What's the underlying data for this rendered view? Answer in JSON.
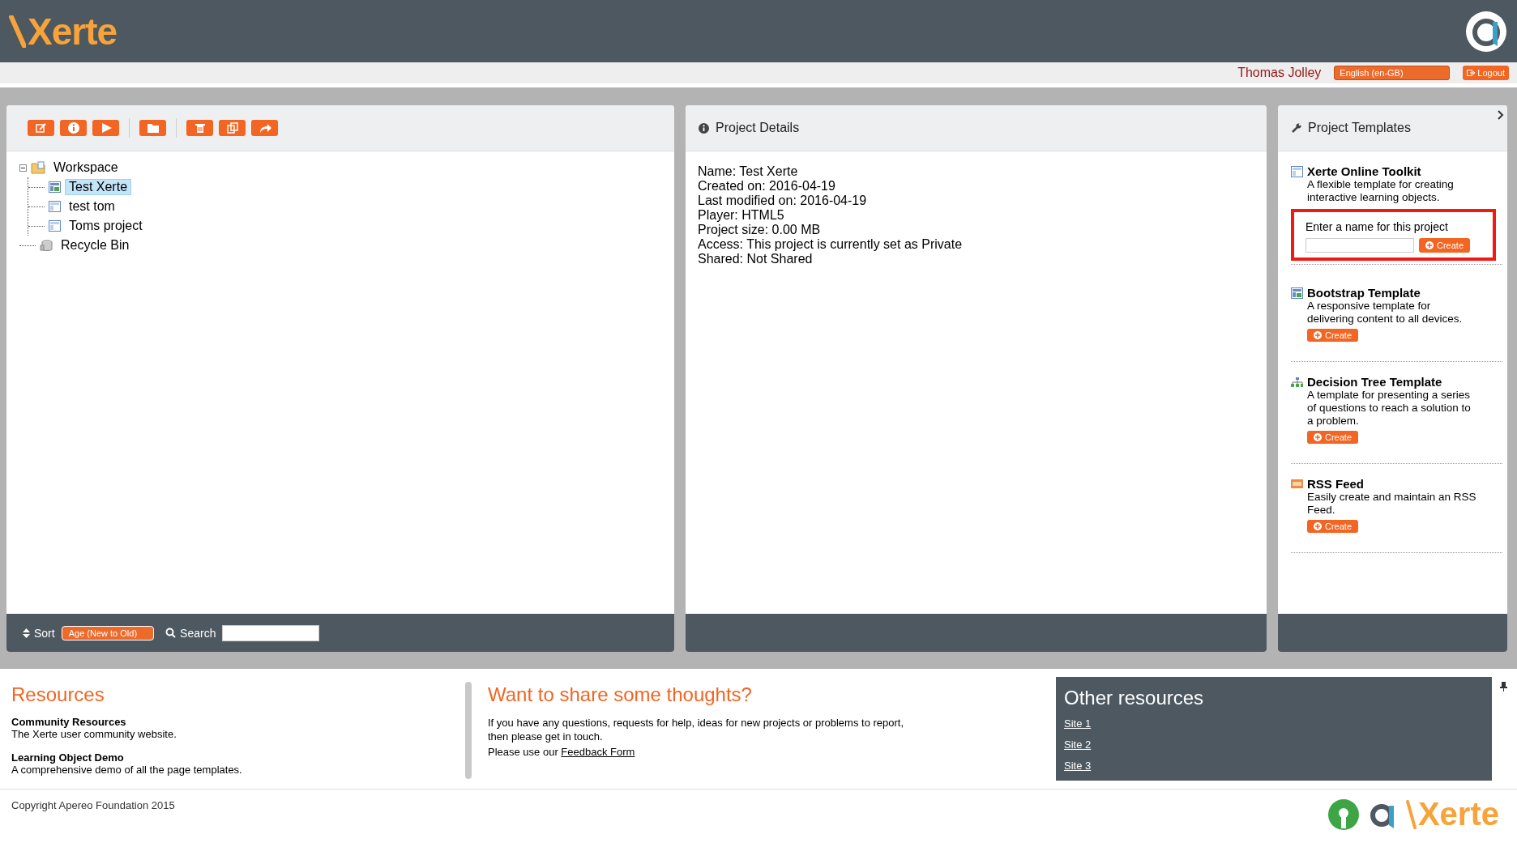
{
  "header": {
    "logo_text": "Xerte",
    "user": "Thomas Jolley",
    "language": "English (en-GB)",
    "logout": "Logout"
  },
  "workspace": {
    "toolbar": [
      {
        "kind": "edit"
      },
      {
        "kind": "info"
      },
      {
        "kind": "play"
      },
      {
        "kind": "sep"
      },
      {
        "kind": "folder"
      },
      {
        "kind": "sep"
      },
      {
        "kind": "delete"
      },
      {
        "kind": "copy"
      },
      {
        "kind": "share"
      }
    ],
    "tree": [
      {
        "label": "Workspace",
        "kind": "folder",
        "expanded": true,
        "selected": false,
        "children": [
          {
            "label": "Test Xerte",
            "kind": "bootstrap",
            "selected": true
          },
          {
            "label": "test tom",
            "kind": "page",
            "selected": false
          },
          {
            "label": "Toms project",
            "kind": "page",
            "selected": false
          }
        ]
      },
      {
        "label": "Recycle Bin",
        "kind": "bin",
        "selected": false
      }
    ],
    "sort_label": "Sort",
    "sort_value": "Age (New to Old)",
    "search_label": "Search"
  },
  "details": {
    "title": "Project Details",
    "lines": [
      "Name: Test Xerte",
      "Created on: 2016-04-19",
      "Last modified on: 2016-04-19",
      "Player: HTML5",
      "Project size: 0.00 MB",
      "Access: This project is currently set as Private",
      "Shared: Not Shared"
    ]
  },
  "templates": {
    "title": "Project Templates",
    "items": [
      {
        "kind": "page",
        "name": "Xerte Online Toolkit",
        "description": "A flexible template for creating interactive learning objects.",
        "expanded": true,
        "name_prompt": "Enter a name for this project",
        "button": "Create"
      },
      {
        "kind": "bootstrap",
        "name": "Bootstrap Template",
        "description": "A responsive template for delivering content to all devices.",
        "expanded": false,
        "button": "Create"
      },
      {
        "kind": "tree",
        "name": "Decision Tree Template",
        "description": "A template for presenting a series of questions to reach a solution to a problem.",
        "expanded": false,
        "button": "Create"
      },
      {
        "kind": "rss",
        "name": "RSS Feed",
        "description": "Easily create and maintain an RSS Feed.",
        "expanded": false,
        "button": "Create"
      }
    ]
  },
  "resources": {
    "title": "Resources",
    "items": [
      {
        "name": "Community Resources",
        "description": "The Xerte user community website."
      },
      {
        "name": "Learning Object Demo",
        "description": "A comprehensive demo of all the page templates."
      }
    ]
  },
  "feedback": {
    "title": "Want to share some thoughts?",
    "text": "If you have any questions, requests for help, ideas for new projects or problems to report, then please get in touch.",
    "prompt": "Please use our",
    "link": "Feedback Form"
  },
  "other_resources": {
    "title": "Other resources",
    "links": [
      "Site 1",
      "Site 2",
      "Site 3"
    ]
  },
  "footer": {
    "copyright": "Copyright Apereo Foundation 2015",
    "logo_text": "Xerte"
  }
}
